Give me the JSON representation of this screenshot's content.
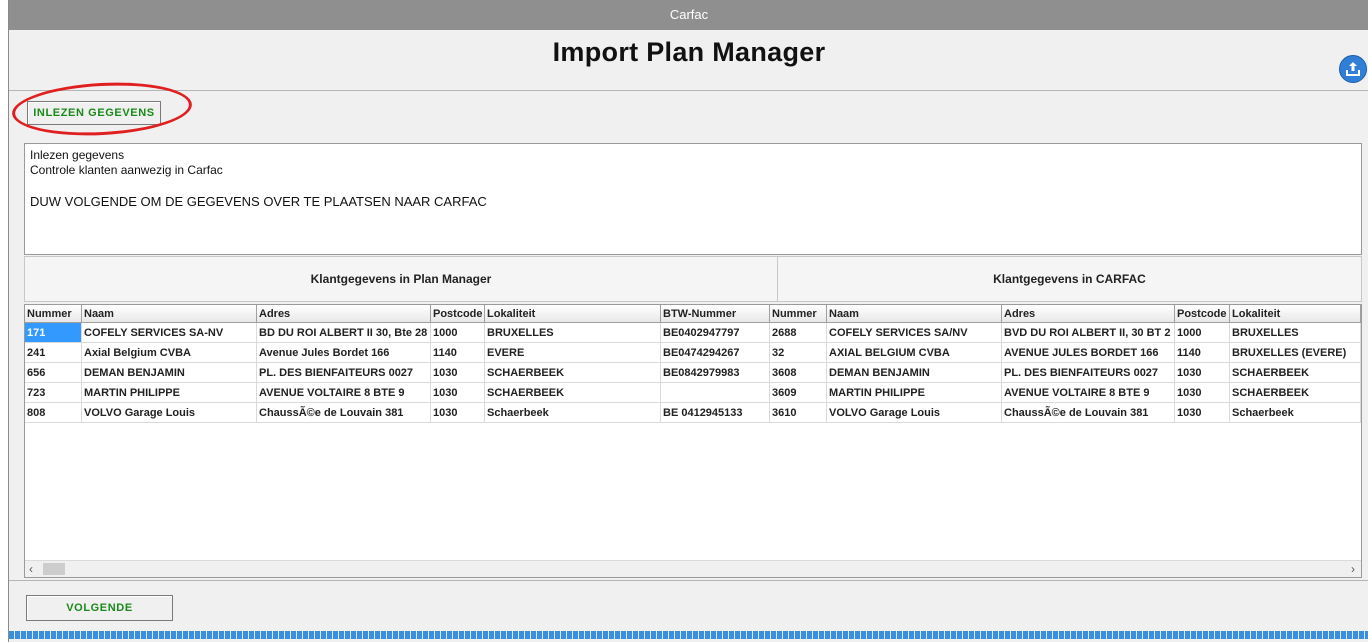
{
  "window": {
    "title": "Carfac"
  },
  "header": {
    "title": "Import Plan Manager",
    "share_icon": "share-upload-icon",
    "accent": "#2f7fd6"
  },
  "actions": {
    "read_button": "INLEZEN GEGEVENS",
    "next_button": "VOLGENDE",
    "button_text_color": "#1a8a1a",
    "highlight_color": "#e02020"
  },
  "log": {
    "lines": [
      "Inlezen gegevens",
      "Controle klanten aanwezig in Carfac"
    ],
    "instruction": "DUW VOLGENDE OM DE GEGEVENS OVER TE PLAATSEN NAAR CARFAC"
  },
  "groups": {
    "left": "Klantgegevens in Plan Manager",
    "right": "Klantgegevens in CARFAC"
  },
  "table": {
    "columns": [
      "Nummer",
      "Naam",
      "Adres",
      "Postcode",
      "Lokaliteit",
      "BTW-Nummer",
      "Nummer",
      "Naam",
      "Adres",
      "Postcode",
      "Lokaliteit"
    ],
    "rows": [
      [
        "171",
        "COFELY SERVICES SA-NV",
        "BD DU ROI ALBERT II 30, Bte 28",
        "1000",
        "BRUXELLES",
        "BE0402947797",
        "2688",
        "COFELY SERVICES SA/NV",
        "BVD DU ROI ALBERT II, 30 BT 2",
        "1000",
        "BRUXELLES"
      ],
      [
        "241",
        "Axial Belgium CVBA",
        "Avenue Jules Bordet 166",
        "1140",
        "EVERE",
        "BE0474294267",
        "32",
        "AXIAL BELGIUM CVBA",
        "AVENUE JULES BORDET 166",
        "1140",
        "BRUXELLES (EVERE)"
      ],
      [
        "656",
        "DEMAN BENJAMIN",
        "PL. DES BIENFAITEURS 0027",
        "1030",
        "SCHAERBEEK",
        "BE0842979983",
        "3608",
        "DEMAN BENJAMIN",
        "PL. DES BIENFAITEURS 0027",
        "1030",
        "SCHAERBEEK"
      ],
      [
        "723",
        "MARTIN PHILIPPE",
        "AVENUE VOLTAIRE 8 BTE 9",
        "1030",
        "SCHAERBEEK",
        "",
        "3609",
        "MARTIN PHILIPPE",
        "AVENUE VOLTAIRE 8 BTE 9",
        "1030",
        "SCHAERBEEK"
      ],
      [
        "808",
        "VOLVO Garage Louis",
        "ChaussÃ©e de Louvain 381",
        "1030",
        "Schaerbeek",
        "BE 0412945133",
        "3610",
        "VOLVO Garage Louis",
        "ChaussÃ©e de Louvain 381",
        "1030",
        "Schaerbeek"
      ]
    ],
    "selected_cell": "171"
  }
}
